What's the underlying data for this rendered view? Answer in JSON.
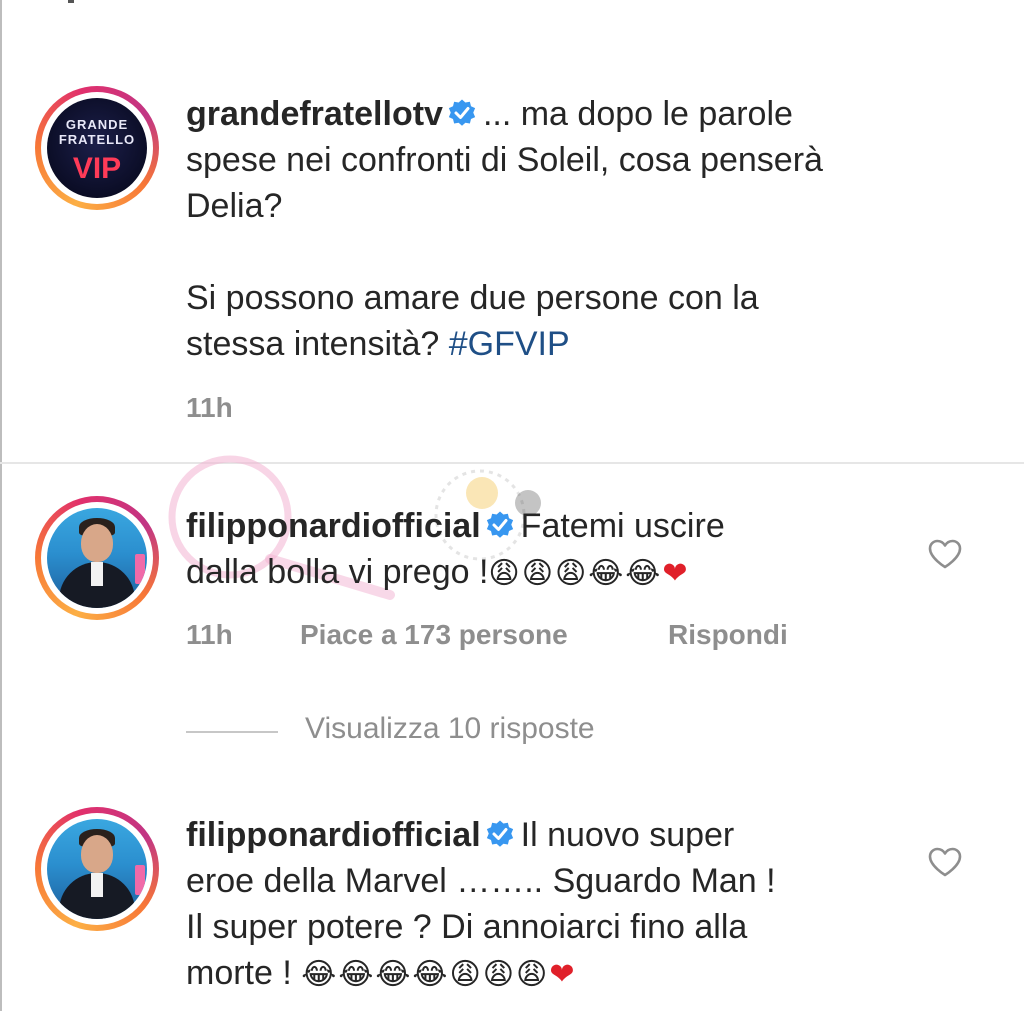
{
  "caption": {
    "username": "grandefratellotv",
    "text_line1": "... ma dopo le parole",
    "text_line2": "spese nei confronti di Soleil, cosa penserà",
    "text_line3": "Delia?",
    "text_line4": "Si possono amare due persone con la",
    "text_line5_prefix": "stessa intensità?",
    "hashtag": "#GFVIP",
    "time": "11h",
    "logo_line1": "GRANDE",
    "logo_line2": "FRATELLO",
    "logo_vip": "VIP"
  },
  "comments": [
    {
      "username": "filipponardiofficial",
      "text_line1": "Fatemi uscire",
      "text_line2": "dalla bolla vi prego !",
      "emojis": "😩😩😩😂😂",
      "heart_emoji": "❤",
      "time": "11h",
      "likes": "Piace a 173 persone",
      "reply": "Rispondi"
    },
    {
      "username": "filipponardiofficial",
      "text_line1": "Il nuovo super",
      "text_line2": "eroe della Marvel …….. Sguardo Man !",
      "text_line3": "Il super potere ? Di annoiarci fino alla",
      "text_line4": "morte !",
      "emojis": "😂😂😂😂😩😩😩",
      "heart_emoji": "❤"
    }
  ],
  "view_replies": "Visualizza 10 risposte",
  "colors": {
    "hashtag": "#1f4f86",
    "verified": "#3897f0",
    "meta": "#8e8e8e",
    "heart_red": "#e0202a"
  }
}
